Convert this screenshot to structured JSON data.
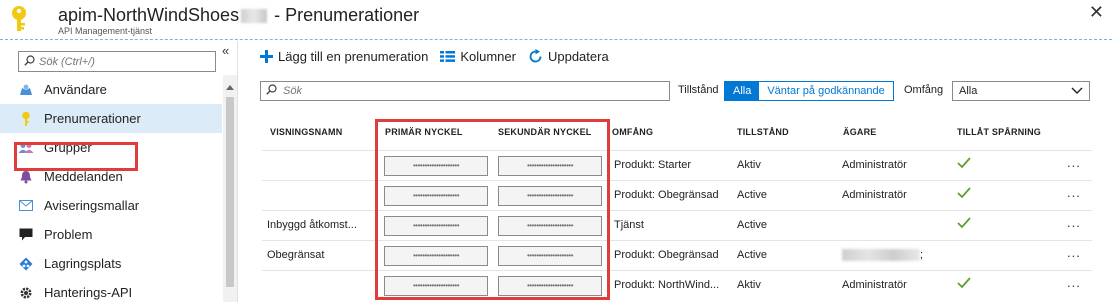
{
  "header": {
    "title_prefix": "apim-NorthWindShoes",
    "title_suffix": " - Prenumerationer",
    "subtitle": "API Management-tjänst",
    "icon": "key-icon",
    "close_glyph": "✕"
  },
  "sidebar": {
    "search_placeholder": "Sök (Ctrl+/)",
    "collapse_glyph": "«",
    "items": [
      {
        "label": "Användare",
        "icon": "users-icon",
        "color": "#4a90d9"
      },
      {
        "label": "Prenumerationer",
        "icon": "key-icon",
        "color": "#f2c811",
        "active": true
      },
      {
        "label": "Grupper",
        "icon": "group-icon",
        "color": "#6a8fd1"
      },
      {
        "label": "Meddelanden",
        "icon": "bell-icon",
        "color": "#7f4d9e"
      },
      {
        "label": "Aviseringsmallar",
        "icon": "mail-icon",
        "color": "#4a90d9"
      },
      {
        "label": "Problem",
        "icon": "chat-icon",
        "color": "#222222"
      },
      {
        "label": "Lagringsplats",
        "icon": "repository-icon",
        "color": "#2a7fd4"
      },
      {
        "label": "Hanterings-API",
        "icon": "gear-icon",
        "color": "#333333"
      }
    ]
  },
  "toolbar": {
    "add_label": "Lägg till en prenumeration",
    "columns_label": "Kolumner",
    "refresh_label": "Uppdatera"
  },
  "filters": {
    "search_placeholder": "Sök",
    "state_label": "Tillstånd",
    "state_options": [
      "Alla",
      "Väntar på godkännande"
    ],
    "state_selected": "Alla",
    "scope_label": "Omfång",
    "scope_value": "Alla"
  },
  "table": {
    "headers": {
      "name": "VISNINGSNAMN",
      "primary": "PRIMÄR NYCKEL",
      "secondary": "SEKUNDÄR NYCKEL",
      "scope": "OMFÅNG",
      "state": "TILLSTÅND",
      "owner": "ÄGARE",
      "tracing": "TILLÅT SPÅRNING"
    },
    "masked_key": "••••••••••••••••••••",
    "more_glyph": "...",
    "rows": [
      {
        "name": "",
        "scope": "Produkt: Starter",
        "state": "Aktiv",
        "owner": "Administratör",
        "tracing": true
      },
      {
        "name": "",
        "scope": "Produkt: Obegränsad",
        "state": "Active",
        "owner": "Administratör",
        "tracing": true
      },
      {
        "name": "Inbyggd åtkomst...",
        "scope": "Tjänst",
        "state": "Active",
        "owner": "",
        "tracing": true
      },
      {
        "name": "Obegränsat",
        "scope": "Produkt: Obegränsad",
        "state": "Active",
        "owner": ";",
        "owner_blurred": true,
        "tracing": false
      },
      {
        "name": "",
        "scope": "Produkt: NorthWind...",
        "state": "Aktiv",
        "owner": "Administratör",
        "tracing": true
      }
    ]
  },
  "colors": {
    "accent": "#0078d4",
    "highlight": "#e03c3c",
    "check": "#5aa02c",
    "active_bg": "#dcebf8"
  }
}
